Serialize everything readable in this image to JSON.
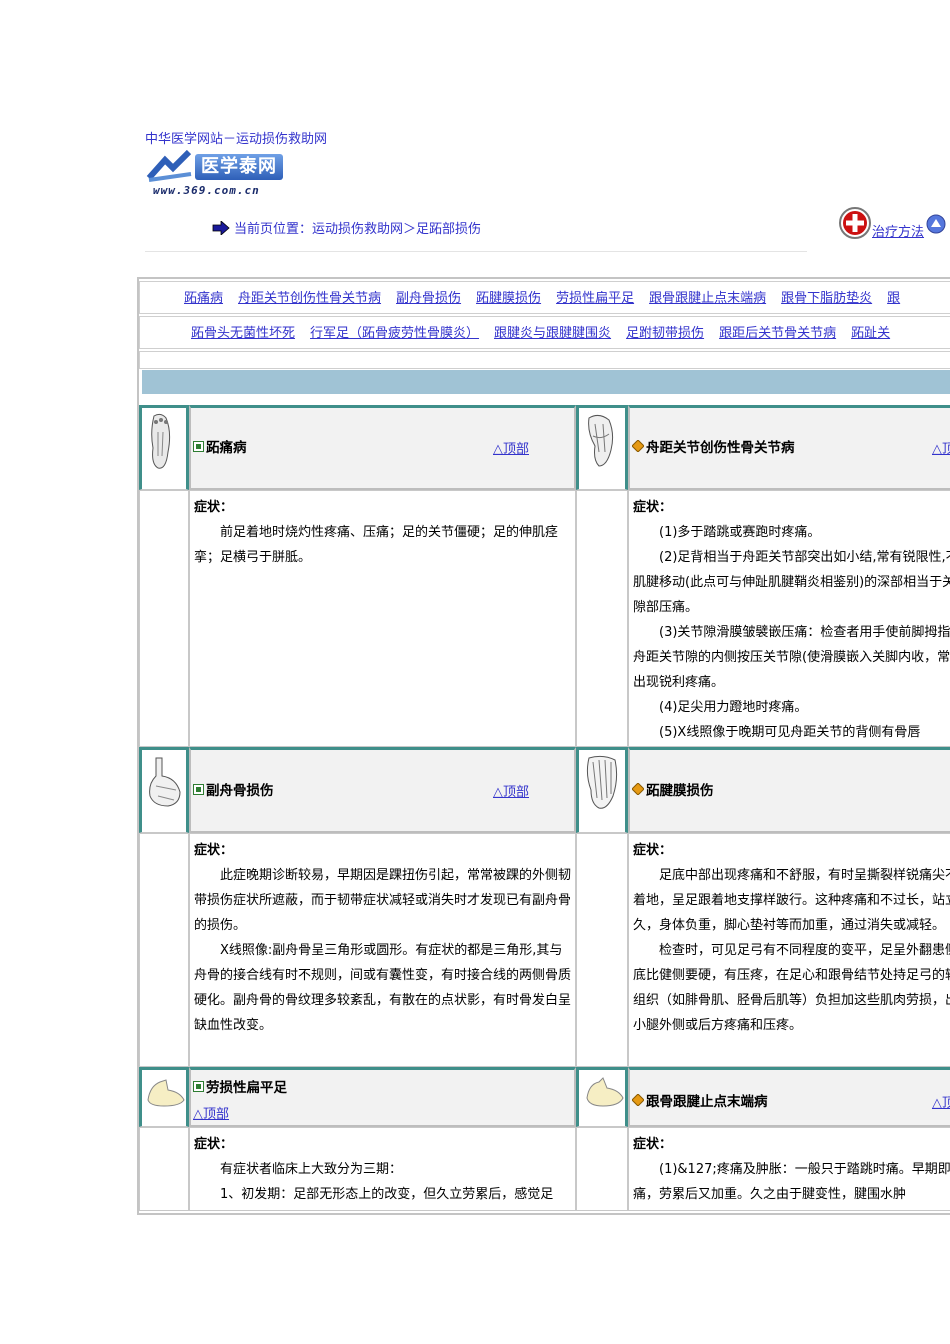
{
  "header": {
    "site_title": "中华医学网站－运动损伤救助网",
    "logo_text": "医学泰网",
    "logo_url": "www.369.com.cn",
    "breadcrumb": "当前页位置：运动损伤救助网＞足跖部损伤",
    "therapy_link": "治疗方法"
  },
  "nav": {
    "row1": [
      "跖痛病",
      "舟距关节创伤性骨关节病",
      "副舟骨损伤",
      "跖腱膜损伤",
      "劳损性扁平足",
      "跟骨跟腱止点末端病",
      "跟骨下脂肪垫炎",
      "跟"
    ],
    "row2": [
      "跖骨头无菌性坏死",
      "行军足（跖骨疲劳性骨膜炎）",
      "跟腱炎与跟腱腱围炎",
      "足跗韧带损伤",
      "跟距后关节骨关节病",
      "跖趾关"
    ]
  },
  "top_label": "△顶部",
  "symptom_label": "症状：",
  "sections": [
    {
      "title": "跖痛病",
      "paras": [
        "前足着地时烧灼性疼痛、压痛；足的关节僵硬；足的伸肌痉挛；足横弓于胼胝。"
      ]
    },
    {
      "title": "舟距关节创伤性骨关节病",
      "paras": [
        "(1)多于踏跳或赛跑时疼痛。",
        "(2)足背相当于舟距关节部突出如小结,常有锐限性,不随肌腱移动(此点可与伸趾肌腱鞘炎相鉴别)的深部相当于关节隙部压痛。",
        "(3)关节隙滑膜皱襞嵌压痛：检查者用手使前脚拇指由舟距关节隙的内侧按压关节隙(使滑膜嵌入关脚内收，常常出现锐利疼痛。",
        "(4)足尖用力蹬地时疼痛。",
        "(5)X线照像于晚期可见舟距关节的背侧有骨唇"
      ]
    },
    {
      "title": "副舟骨损伤",
      "paras": [
        "此症晚期诊断较易，早期因是踝扭伤引起，常常被踝的外侧韧带损伤症状所遮蔽，而于韧带症状减轻或消失时才发现已有副舟骨的损伤。",
        "X线照像:副舟骨呈三角形或圆形。有症状的都是三角形,其与舟骨的接合线有时不规则，间或有囊性变，有时接合线的两侧骨质硬化。副舟骨的骨纹理多较紊乱，有散在的点状影，有时骨发白呈缺血性改变。"
      ]
    },
    {
      "title": "跖腱膜损伤",
      "paras": [
        "足底中部出现疼痛和不舒服，有时呈撕裂样锐痛尖不能着地，呈足跟着地支撑样跛行。这种疼痛和不过长，站立过久，身体负重，脚心垫衬等而加重，通过消失或减轻。",
        "检查时，可见足弓有不同程度的变平，足呈外翻患侧足底比健侧要硬，有压疼，在足心和跟骨结节处持足弓的辅助组织（如腓骨肌、胫骨后肌等）负担加这些肌肉劳损，出现小腿外侧或后方疼痛和压疼。"
      ]
    },
    {
      "title": "劳损性扁平足",
      "paras": [
        "有症状者临床上大致分为三期：",
        "1、初发期：足部无形态上的改变，但久立劳累后，感觉足"
      ]
    },
    {
      "title": "跟骨跟腱止点末端病",
      "paras": [
        "(1)&127;疼痛及肿胀：一般只于踏跳时痛。早期即不痛，劳累后又加重。久之由于腱变性，腱围水肿"
      ]
    }
  ]
}
